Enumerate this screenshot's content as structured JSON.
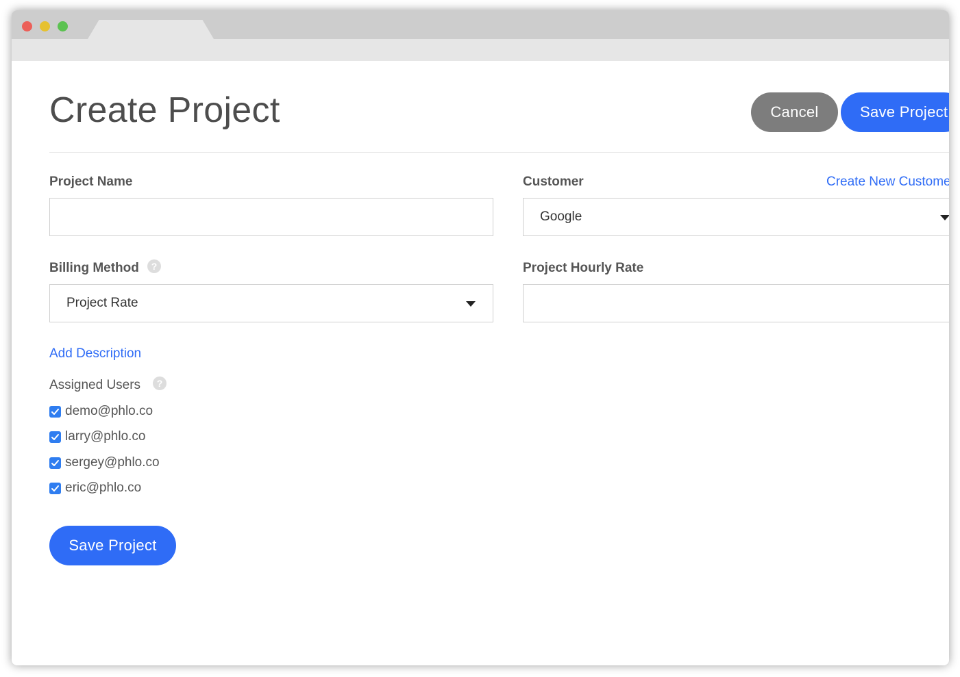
{
  "browser": {
    "tab_title": ""
  },
  "page": {
    "title": "Create Project"
  },
  "header_actions": {
    "cancel_label": "Cancel",
    "save_label": "Save Project"
  },
  "form": {
    "project_name": {
      "label": "Project Name",
      "value": ""
    },
    "customer": {
      "label": "Customer",
      "create_link": "Create New Customer",
      "selected": "Google"
    },
    "billing_method": {
      "label": "Billing Method",
      "selected": "Project Rate"
    },
    "hourly_rate": {
      "label": "Project Hourly Rate",
      "value": ""
    },
    "add_description_link": "Add Description",
    "assigned_users": {
      "label": "Assigned Users",
      "users": [
        {
          "email": "demo@phlo.co",
          "checked": true
        },
        {
          "email": "larry@phlo.co",
          "checked": true
        },
        {
          "email": "sergey@phlo.co",
          "checked": true
        },
        {
          "email": "eric@phlo.co",
          "checked": true
        }
      ]
    },
    "save_label": "Save Project"
  },
  "icons": {
    "help": "help-icon",
    "caret": "chevron-down-icon",
    "check": "checkmark-icon"
  },
  "colors": {
    "primary": "#2f6cf6",
    "cancel": "#7d7d7d",
    "checkbox": "#2f7df0"
  }
}
